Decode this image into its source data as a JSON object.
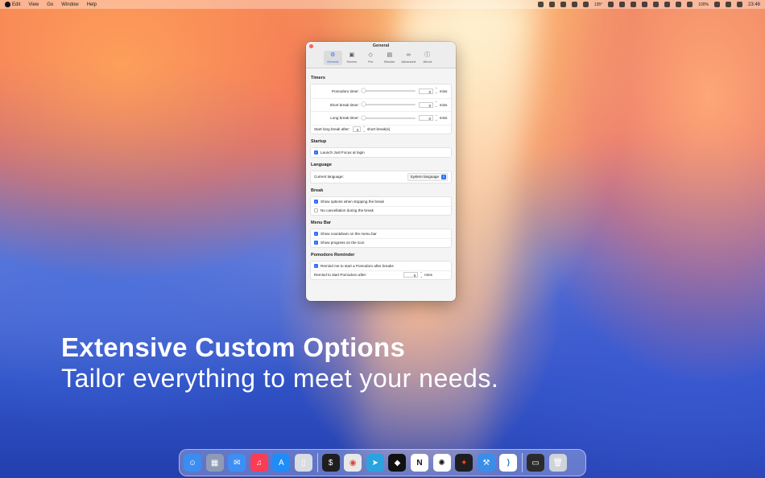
{
  "menubar": {
    "menus": [
      "Edit",
      "View",
      "Go",
      "Window",
      "Help"
    ],
    "temperature": "135°",
    "battery_small": "100%",
    "clock": "23:46"
  },
  "window": {
    "title": "General",
    "tabs": [
      {
        "label": "General",
        "icon": "gear-icon",
        "glyph": "⚙",
        "active": true
      },
      {
        "label": "Screen",
        "icon": "screen-icon",
        "glyph": "▣",
        "active": false
      },
      {
        "label": "Pro",
        "icon": "diamond-icon",
        "glyph": "◇",
        "active": false
      },
      {
        "label": "Blocker",
        "icon": "blocker-icon",
        "glyph": "▤",
        "active": false
      },
      {
        "label": "Advanced",
        "icon": "advanced-icon",
        "glyph": "∞",
        "active": false
      },
      {
        "label": "About",
        "icon": "info-icon",
        "glyph": "ⓘ",
        "active": false
      }
    ],
    "timers": {
      "title": "Timers",
      "pomodoro_label": "Pomodoro timer:",
      "pomodoro_value": "0",
      "short_label": "Short break timer:",
      "short_value": "0",
      "long_label": "Long break timer:",
      "long_value": "0",
      "unit": "mins",
      "start_long_label": "Start long break after:",
      "start_long_value": "3",
      "start_long_unit": "short break(s)"
    },
    "startup": {
      "title": "Startup",
      "launch_label": "Launch Just Focus at login"
    },
    "language": {
      "title": "Language",
      "current_label": "Current language:",
      "current_value": "System language"
    },
    "break": {
      "title": "Break",
      "show_options_label": "Show options when stopping the break",
      "no_cancel_label": "No cancellation during the break"
    },
    "menu_bar": {
      "title": "Menu Bar",
      "countdown_label": "Show countdown on the menu bar",
      "progress_label": "Show progress on the icon"
    },
    "reminder": {
      "title": "Pomodoro Reminder",
      "remind_label": "Remind me to start a Pomodoro after breaks",
      "remind_after_label": "Remind to start Pomodoro after:",
      "remind_after_value": "5",
      "unit": "mins"
    }
  },
  "promo": {
    "headline": "Extensive Custom Options",
    "subline": "Tailor everything to meet your needs."
  },
  "dock": {
    "apps": [
      {
        "name": "finder",
        "color": "#3b8df0",
        "glyph": "☺"
      },
      {
        "name": "launchpad",
        "color": "#8f9bb5",
        "glyph": "▦"
      },
      {
        "name": "mail",
        "color": "#3e8ff5",
        "glyph": "✉"
      },
      {
        "name": "music",
        "color": "#fa3c55",
        "glyph": "♫"
      },
      {
        "name": "app-store",
        "color": "#1f8df7",
        "glyph": "A"
      },
      {
        "name": "iphone-mirroring",
        "color": "#d9dce3",
        "glyph": "▯"
      },
      {
        "name": "terminal",
        "color": "#1e1e1e",
        "glyph": "$"
      },
      {
        "name": "chrome",
        "color": "#e8e8e8",
        "glyph": "◉"
      },
      {
        "name": "telegram",
        "color": "#2aa3e0",
        "glyph": "➤"
      },
      {
        "name": "box-app",
        "color": "#111111",
        "glyph": "◆"
      },
      {
        "name": "notion",
        "color": "#ffffff",
        "glyph": "N"
      },
      {
        "name": "chatgpt",
        "color": "#ffffff",
        "glyph": "✺"
      },
      {
        "name": "figma",
        "color": "#1e1e1e",
        "glyph": "✦"
      },
      {
        "name": "xcode",
        "color": "#3a8de8",
        "glyph": "⚒"
      },
      {
        "name": "vscode",
        "color": "#ffffff",
        "glyph": "⟩"
      },
      {
        "name": "terminal-window",
        "color": "#2b2b2b",
        "glyph": "▭"
      },
      {
        "name": "trash",
        "color": "#cfd3da",
        "glyph": "🗑"
      }
    ]
  }
}
